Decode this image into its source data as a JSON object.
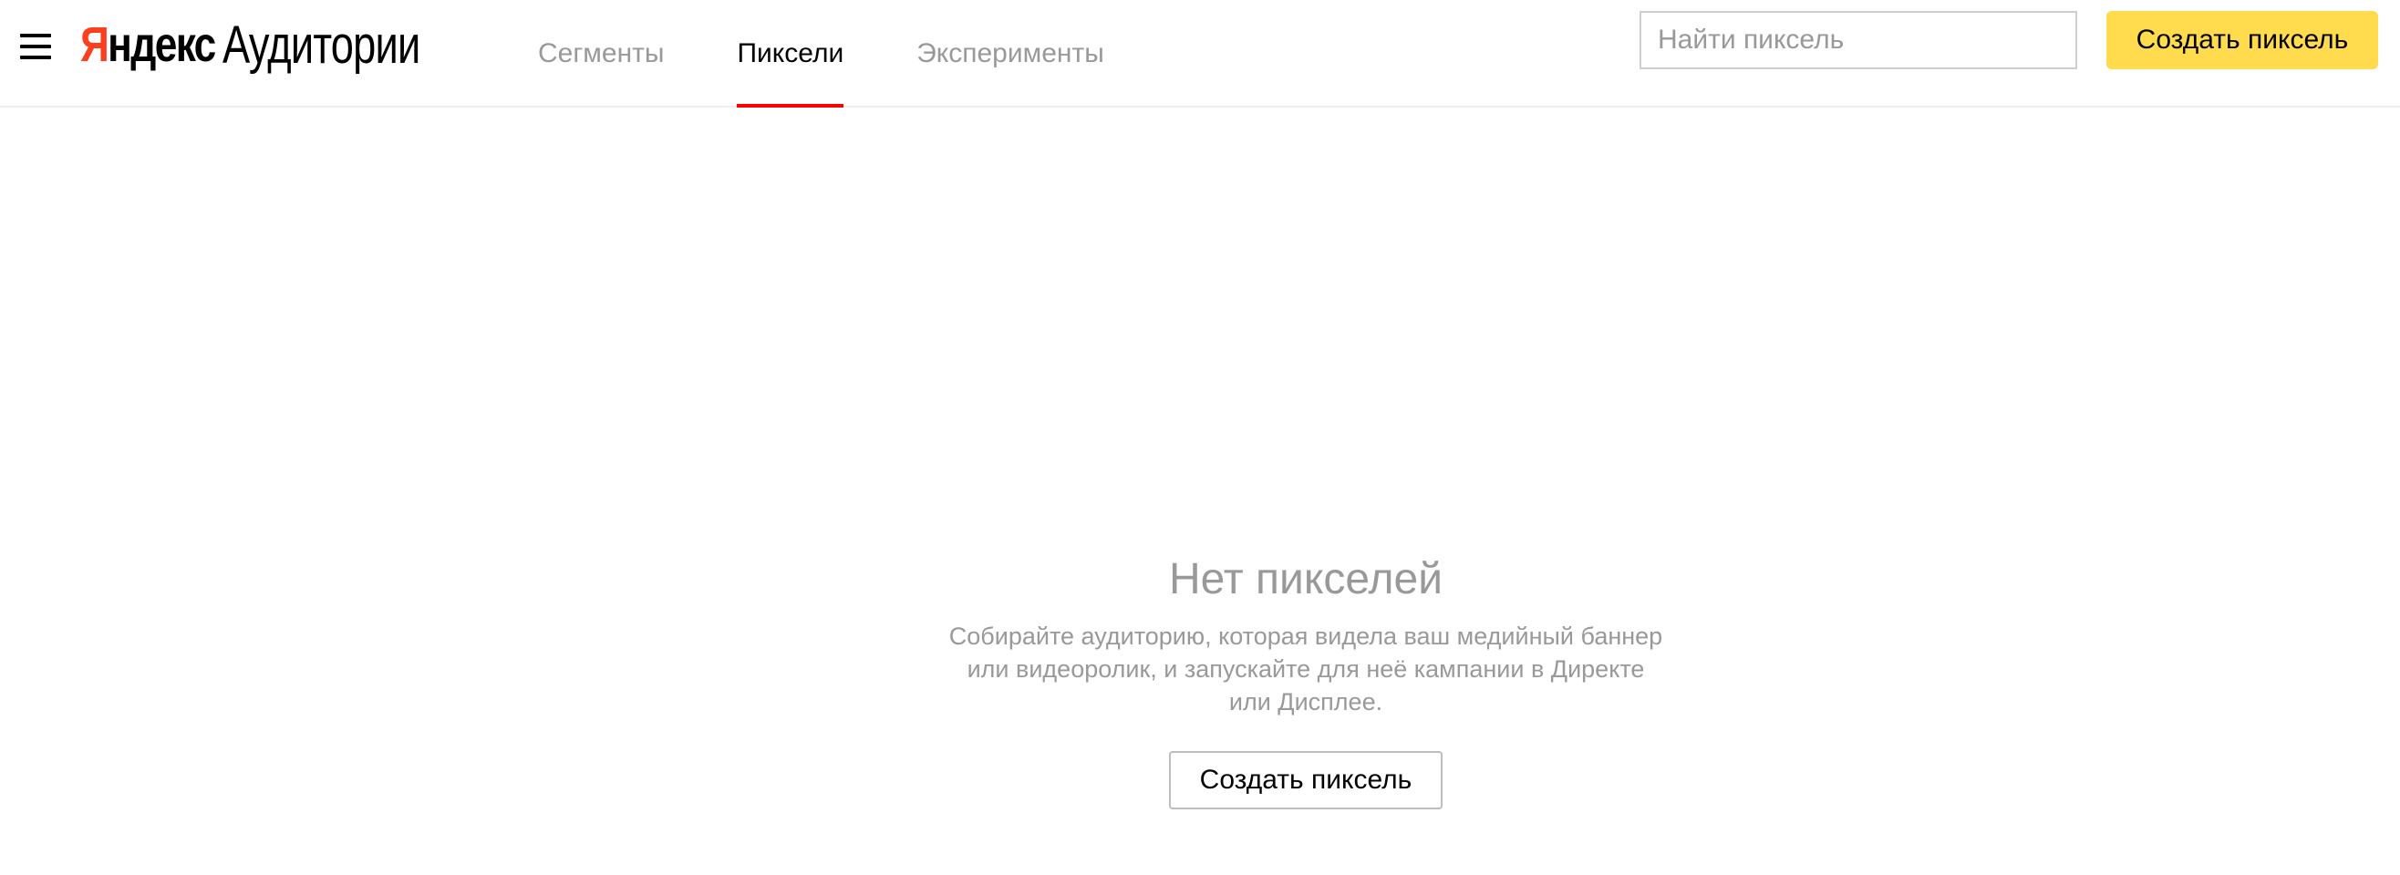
{
  "header": {
    "logo_brand": "Яндекс",
    "logo_product": "Аудитории",
    "tabs": [
      {
        "label": "Сегменты",
        "active": false
      },
      {
        "label": "Пиксели",
        "active": true
      },
      {
        "label": "Эксперименты",
        "active": false
      }
    ],
    "search_placeholder": "Найти пиксель",
    "search_value": "",
    "create_button_label": "Создать пиксель",
    "icons": {
      "menu": "hamburger-menu-icon"
    }
  },
  "empty_state": {
    "title": "Нет пикселей",
    "description": "Собирайте аудиторию, которая видела ваш медийный баннер или видеоролик, и запускайте для неё кампании в Директе или Дисплее.",
    "button_label": "Создать пиксель"
  },
  "colors": {
    "accent_yellow": "#ffdb4d",
    "active_tab_underline": "#ff0000",
    "logo_red": "#fc3f1d",
    "muted_text": "#999999"
  }
}
